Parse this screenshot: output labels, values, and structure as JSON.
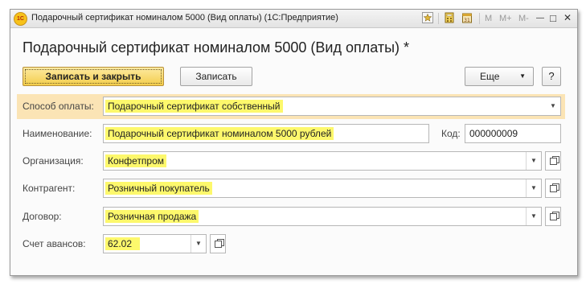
{
  "window": {
    "title": "Подарочный сертификат номиналом 5000 (Вид оплаты)  (1С:Предприятие)",
    "logo_text": "1C",
    "m_label": "M",
    "m_plus_label": "M+",
    "m_minus_label": "M-",
    "minimize": "—",
    "maximize": "□",
    "close": "✕"
  },
  "form": {
    "heading": "Подарочный сертификат номиналом 5000 (Вид оплаты) *"
  },
  "toolbar": {
    "save_close_label": "Записать и закрыть",
    "save_label": "Записать",
    "more_label": "Еще",
    "more_arrow": "▼",
    "help_label": "?"
  },
  "fields": {
    "payment_method": {
      "label": "Способ оплаты:",
      "value": "Подарочный сертификат собственный"
    },
    "name": {
      "label": "Наименование:",
      "value": "Подарочный сертификат номиналом 5000 рублей"
    },
    "code": {
      "label": "Код:",
      "value": "000000009"
    },
    "organization": {
      "label": "Организация:",
      "value": "Конфетпром"
    },
    "counterparty": {
      "label": "Контрагент:",
      "value": "Розничный покупатель"
    },
    "contract": {
      "label": "Договор:",
      "value": "Розничная продажа"
    },
    "advance_account": {
      "label": "Счет авансов:",
      "value": "62.02"
    }
  },
  "dropdown_arrow": "▼",
  "colors": {
    "highlight": "#fdf86c",
    "row_highlight": "#fbe4b5",
    "primary_button": "#f3cd4a"
  }
}
